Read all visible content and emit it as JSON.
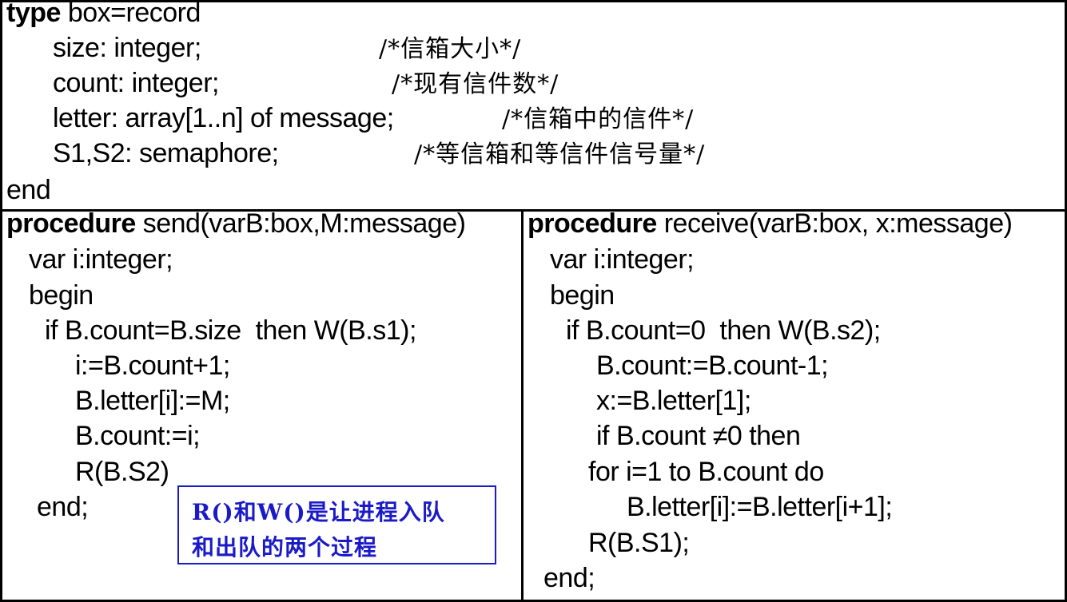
{
  "record": {
    "lines": [
      {
        "kw": "type",
        "code": " box=record",
        "comment": ""
      },
      {
        "kw": "",
        "code": "size: integer;",
        "comment": "/*信箱大小*/"
      },
      {
        "kw": "",
        "code": "count: integer;",
        "comment": "/*现有信件数*/"
      },
      {
        "kw": "",
        "code": "letter: array[1..n] of message;",
        "comment": "/*信箱中的信件*/"
      },
      {
        "kw": "",
        "code": "S1,S2: semaphore;",
        "comment": "/*等信箱和等信件信号量*/"
      },
      {
        "kw": "",
        "code": "end",
        "comment": ""
      }
    ]
  },
  "send": {
    "kw": "procedure",
    "header": " send(varB:box,M:message)",
    "lines": [
      "var i:integer;",
      "begin",
      "if B.count=B.size  then W(B.s1);",
      "i:=B.count+1;",
      "B.letter[i]:=M;",
      "B.count:=i;",
      "R(B.S2)",
      "end;"
    ]
  },
  "receive": {
    "kw": "procedure",
    "header": " receive(varB:box, x:message)",
    "lines": [
      "var i:integer;",
      "begin",
      "if B.count=0  then W(B.s2);",
      "B.count:=B.count-1;",
      "x:=B.letter[1];",
      "if B.count ≠0 then",
      "for i=1 to B.count do",
      "B.letter[i]:=B.letter[i+1];",
      "R(B.S1);",
      "end;"
    ]
  },
  "note": {
    "line1": "R()和W()是让进程入队",
    "line2": "和出队的两个过程"
  },
  "colors": {
    "note": "#1a1ac8",
    "border": "#000000"
  }
}
